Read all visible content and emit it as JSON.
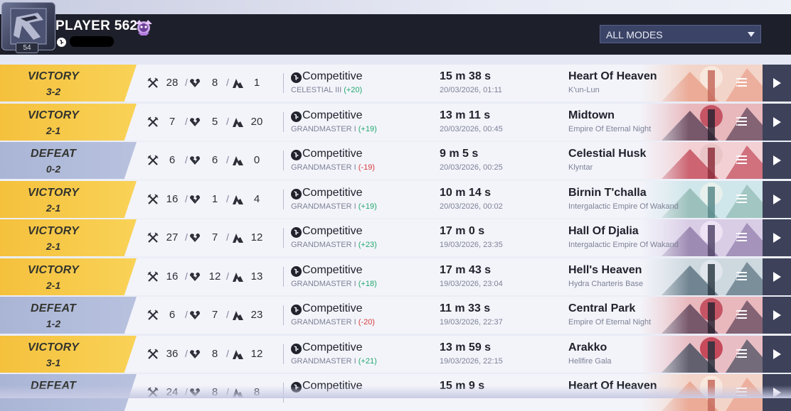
{
  "player": {
    "name": "PLAYER 562",
    "level": "54"
  },
  "filter": {
    "selected": "ALL MODES"
  },
  "colors": {
    "victory": "#f5c13d",
    "defeat": "#aab5d6",
    "gain": "#22a86d",
    "loss": "#d63a3a",
    "header": "#1d1f2b"
  },
  "icons": {
    "kills": "crossed-swords-icon",
    "deaths": "broken-heart-icon",
    "assists": "assist-hand-icon",
    "platform": "playstation-icon",
    "menu": "menu-lines-icon",
    "play": "play-icon"
  },
  "matches": [
    {
      "result": "VICTORY",
      "score": "3-2",
      "kills": "28",
      "deaths": "8",
      "assists": "1",
      "mode": "Competitive",
      "rank": "CELESTIAL III",
      "delta": "(+20)",
      "duration": "15 m 38 s",
      "date": "20/03/2026, 01:11",
      "map": "Heart Of Heaven",
      "region": "K'un-Lun",
      "theme": "heaven"
    },
    {
      "result": "VICTORY",
      "score": "2-1",
      "kills": "7",
      "deaths": "5",
      "assists": "20",
      "mode": "Competitive",
      "rank": "GRANDMASTER I",
      "delta": "(+19)",
      "duration": "13 m 11 s",
      "date": "20/03/2026, 00:45",
      "map": "Midtown",
      "region": "Empire Of Eternal Night",
      "theme": "night"
    },
    {
      "result": "DEFEAT",
      "score": "0-2",
      "kills": "6",
      "deaths": "6",
      "assists": "0",
      "mode": "Competitive",
      "rank": "GRANDMASTER I",
      "delta": "(-19)",
      "duration": "9 m 5 s",
      "date": "20/03/2026, 00:25",
      "map": "Celestial Husk",
      "region": "Klyntar",
      "theme": "klyntar"
    },
    {
      "result": "VICTORY",
      "score": "2-1",
      "kills": "16",
      "deaths": "1",
      "assists": "4",
      "mode": "Competitive",
      "rank": "GRANDMASTER I",
      "delta": "(+19)",
      "duration": "10 m 14 s",
      "date": "20/03/2026, 00:02",
      "map": "Birnin T'challa",
      "region": "Intergalactic Empire Of Wakanda",
      "theme": "wakanda"
    },
    {
      "result": "VICTORY",
      "score": "2-1",
      "kills": "27",
      "deaths": "7",
      "assists": "12",
      "mode": "Competitive",
      "rank": "GRANDMASTER I",
      "delta": "(+23)",
      "duration": "17 m 0 s",
      "date": "19/03/2026, 23:35",
      "map": "Hall Of Djalia",
      "region": "Intergalactic Empire Of Wakanda",
      "theme": "djalia"
    },
    {
      "result": "VICTORY",
      "score": "2-1",
      "kills": "16",
      "deaths": "12",
      "assists": "13",
      "mode": "Competitive",
      "rank": "GRANDMASTER I",
      "delta": "(+18)",
      "duration": "17 m 43 s",
      "date": "19/03/2026, 23:04",
      "map": "Hell's Heaven",
      "region": "Hydra Charteris Base",
      "theme": "hydra"
    },
    {
      "result": "DEFEAT",
      "score": "1-2",
      "kills": "6",
      "deaths": "7",
      "assists": "23",
      "mode": "Competitive",
      "rank": "GRANDMASTER I",
      "delta": "(-20)",
      "duration": "11 m 33 s",
      "date": "19/03/2026, 22:37",
      "map": "Central Park",
      "region": "Empire Of Eternal Night",
      "theme": "night"
    },
    {
      "result": "VICTORY",
      "score": "3-1",
      "kills": "36",
      "deaths": "8",
      "assists": "12",
      "mode": "Competitive",
      "rank": "GRANDMASTER I",
      "delta": "(+21)",
      "duration": "13 m 59 s",
      "date": "19/03/2026, 22:15",
      "map": "Arakko",
      "region": "Hellfire Gala",
      "theme": "arakko"
    },
    {
      "result": "DEFEAT",
      "score": "",
      "kills": "24",
      "deaths": "8",
      "assists": "8",
      "mode": "Competitive",
      "rank": "",
      "delta": "",
      "duration": "15 m 9 s",
      "date": "",
      "map": "Heart Of Heaven",
      "region": "",
      "theme": "heaven"
    }
  ]
}
